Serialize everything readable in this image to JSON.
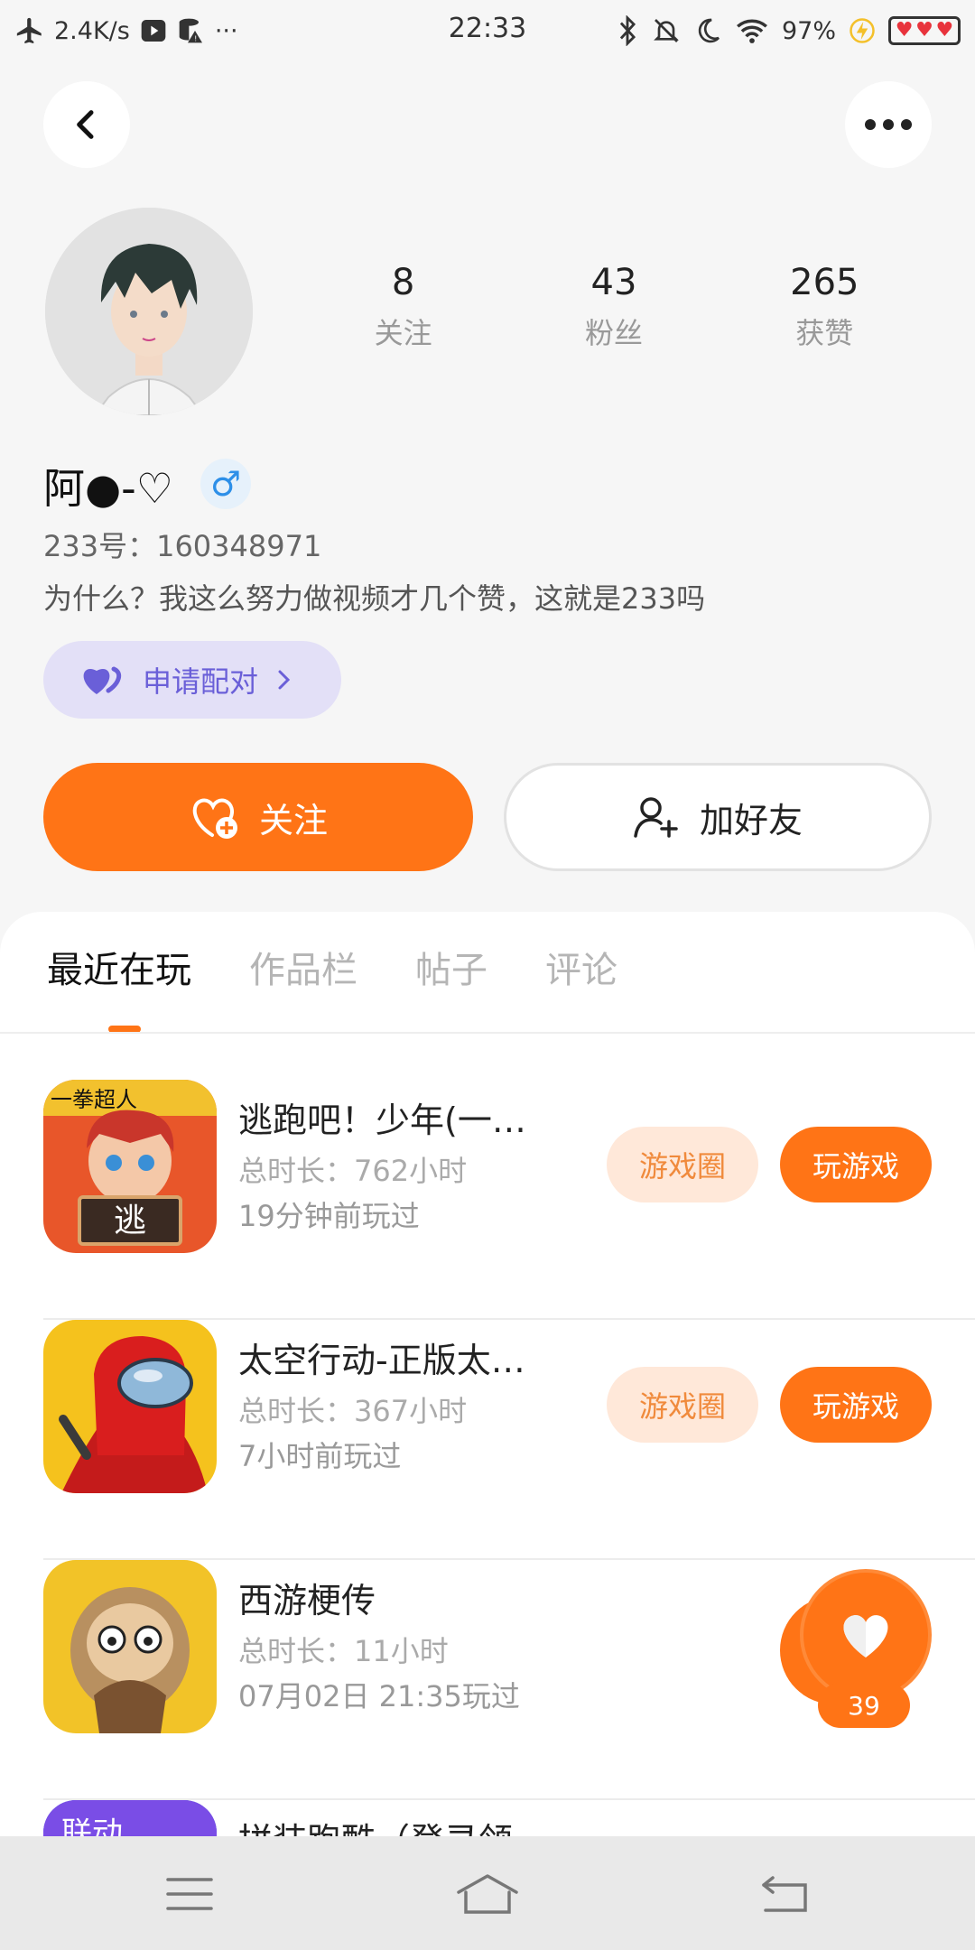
{
  "status_bar": {
    "net_speed": "2.4K/s",
    "dots": "···",
    "time": "22:33",
    "battery_pct": "97%"
  },
  "profile": {
    "stats": [
      {
        "num": "8",
        "label": "关注"
      },
      {
        "num": "43",
        "label": "粉丝"
      },
      {
        "num": "265",
        "label": "获赞"
      }
    ],
    "nickname": "阿●-♡",
    "gender_symbol": "♂",
    "user_id": "233号：160348971",
    "bio": "为什么？我这么努力做视频才几个赞，这就是233吗",
    "pair_label": "申请配对",
    "follow_label": "关注",
    "add_friend_label": "加好友"
  },
  "tabs": [
    "最近在玩",
    "作品栏",
    "帖子",
    "评论"
  ],
  "games": [
    {
      "title": "逃跑吧！少年(一…",
      "duration": "总时长：762小时",
      "last_played": "19分钟前玩过",
      "circle_label": "游戏圈",
      "play_label": "玩游戏",
      "icon_text": "逃",
      "icon_banner": "一拳超人"
    },
    {
      "title": "太空行动-正版太…",
      "duration": "总时长：367小时",
      "last_played": "7小时前玩过",
      "circle_label": "游戏圈",
      "play_label": "玩游戏"
    },
    {
      "title": "西游梗传",
      "duration": "总时长：11小时",
      "last_played": "07月02日 21:35玩过"
    },
    {
      "title": "拼装跑酷（登录领…",
      "icon_text": "联动"
    }
  ],
  "like_fab": {
    "count": "39"
  },
  "colors": {
    "accent": "#ff7416",
    "pair_bg": "#e3e0f7",
    "pair_text": "#6a5fd8",
    "circle_bg": "#ffe8d9"
  }
}
